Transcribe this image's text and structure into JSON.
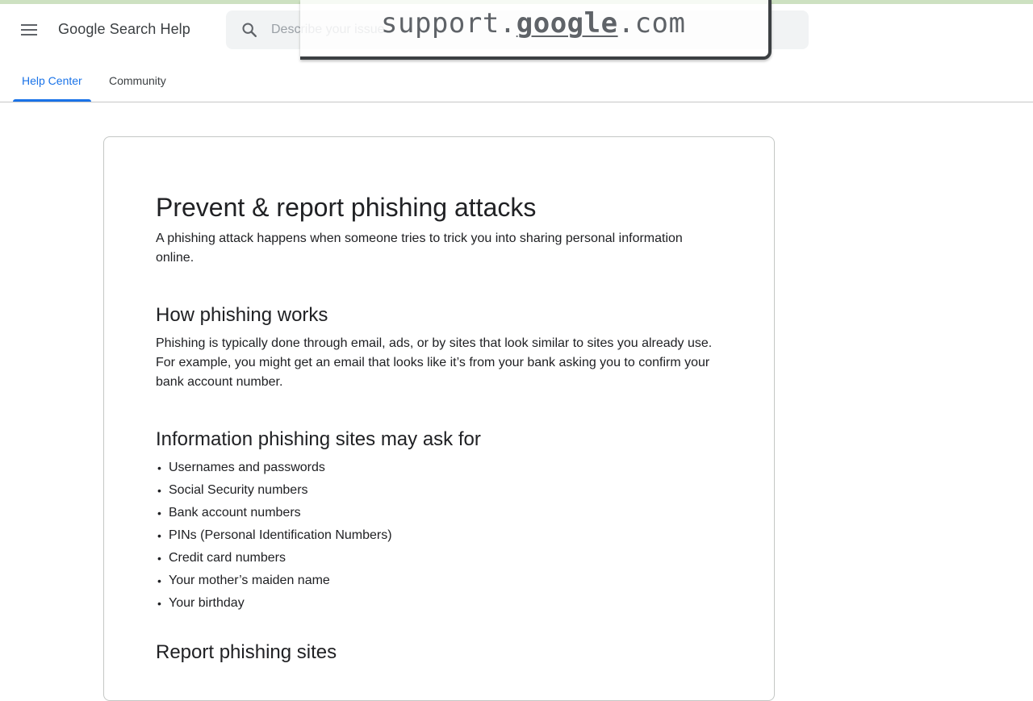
{
  "url_overlay": {
    "prefix": "support.",
    "domain": "google",
    "suffix": ".com"
  },
  "header": {
    "product_title": "Google Search Help",
    "search_placeholder": "Describe your issue"
  },
  "tabs": [
    {
      "label": "Help Center",
      "active": true
    },
    {
      "label": "Community",
      "active": false
    }
  ],
  "article": {
    "title": "Prevent & report phishing attacks",
    "intro": "A phishing attack happens when someone tries to trick you into sharing personal information online.",
    "section1": {
      "heading": "How phishing works",
      "body": "Phishing is typically done through email, ads, or by sites that look similar to sites you already use. For example, you might get an email that looks like it’s from your bank asking you to confirm your bank account number."
    },
    "section2": {
      "heading": "Information phishing sites may ask for",
      "items": [
        "Usernames and passwords",
        "Social Security numbers",
        "Bank account numbers",
        "PINs (Personal Identification Numbers)",
        "Credit card numbers",
        "Your mother’s maiden name",
        "Your birthday"
      ]
    },
    "section3": {
      "heading": "Report phishing sites"
    }
  },
  "colors": {
    "accent": "#1a73e8",
    "text": "#202124",
    "search_bg": "#f1f3f4",
    "top_strip": "#cde1c1"
  },
  "icons": {
    "menu": "hamburger-menu-icon",
    "search": "search-icon"
  }
}
